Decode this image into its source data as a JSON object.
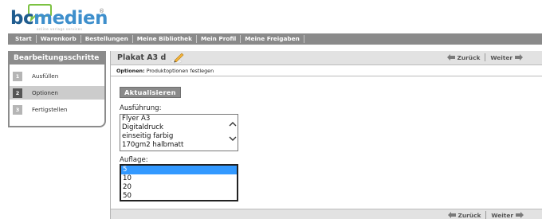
{
  "logo": {
    "text_main": "bc",
    "text_accent": "medien",
    "registered": "®",
    "tagline": "online verlags services"
  },
  "topnav": {
    "items": [
      "Start",
      "Warenkorb",
      "Bestellungen",
      "Meine Bibliothek",
      "Mein Profil",
      "Meine Freigaben"
    ]
  },
  "sidebar": {
    "title": "Bearbeitungsschritte",
    "steps": [
      {
        "num": "1",
        "label": "Ausfüllen"
      },
      {
        "num": "2",
        "label": "Optionen"
      },
      {
        "num": "3",
        "label": "Fertigstellen"
      }
    ],
    "active_step": 2
  },
  "main": {
    "title": "Plakat A3 d",
    "nav_back": "Zurück",
    "nav_next": "Weiter",
    "subheader_label": "Optionen:",
    "subheader_text": "Produktoptionen festlegen",
    "update_button": "Aktualisieren",
    "ausfuehrung_label": "Ausführung:",
    "ausfuehrung_options": [
      "Flyer A3",
      "Digitaldruck",
      "einseitig farbig",
      "170gm2 halbmatt"
    ],
    "auflage_label": "Auflage:",
    "auflage_options": [
      "5",
      "10",
      "20",
      "50"
    ],
    "auflage_selected": "5"
  },
  "colors": {
    "nav_bg": "#8a8a8a",
    "brand_blue": "#1f5c8f",
    "selection": "#3399ff",
    "header_bg": "#e2e2e2"
  },
  "icons": {
    "pen": "pen-icon",
    "back": "arrow-left-icon",
    "next": "arrow-right-icon"
  }
}
